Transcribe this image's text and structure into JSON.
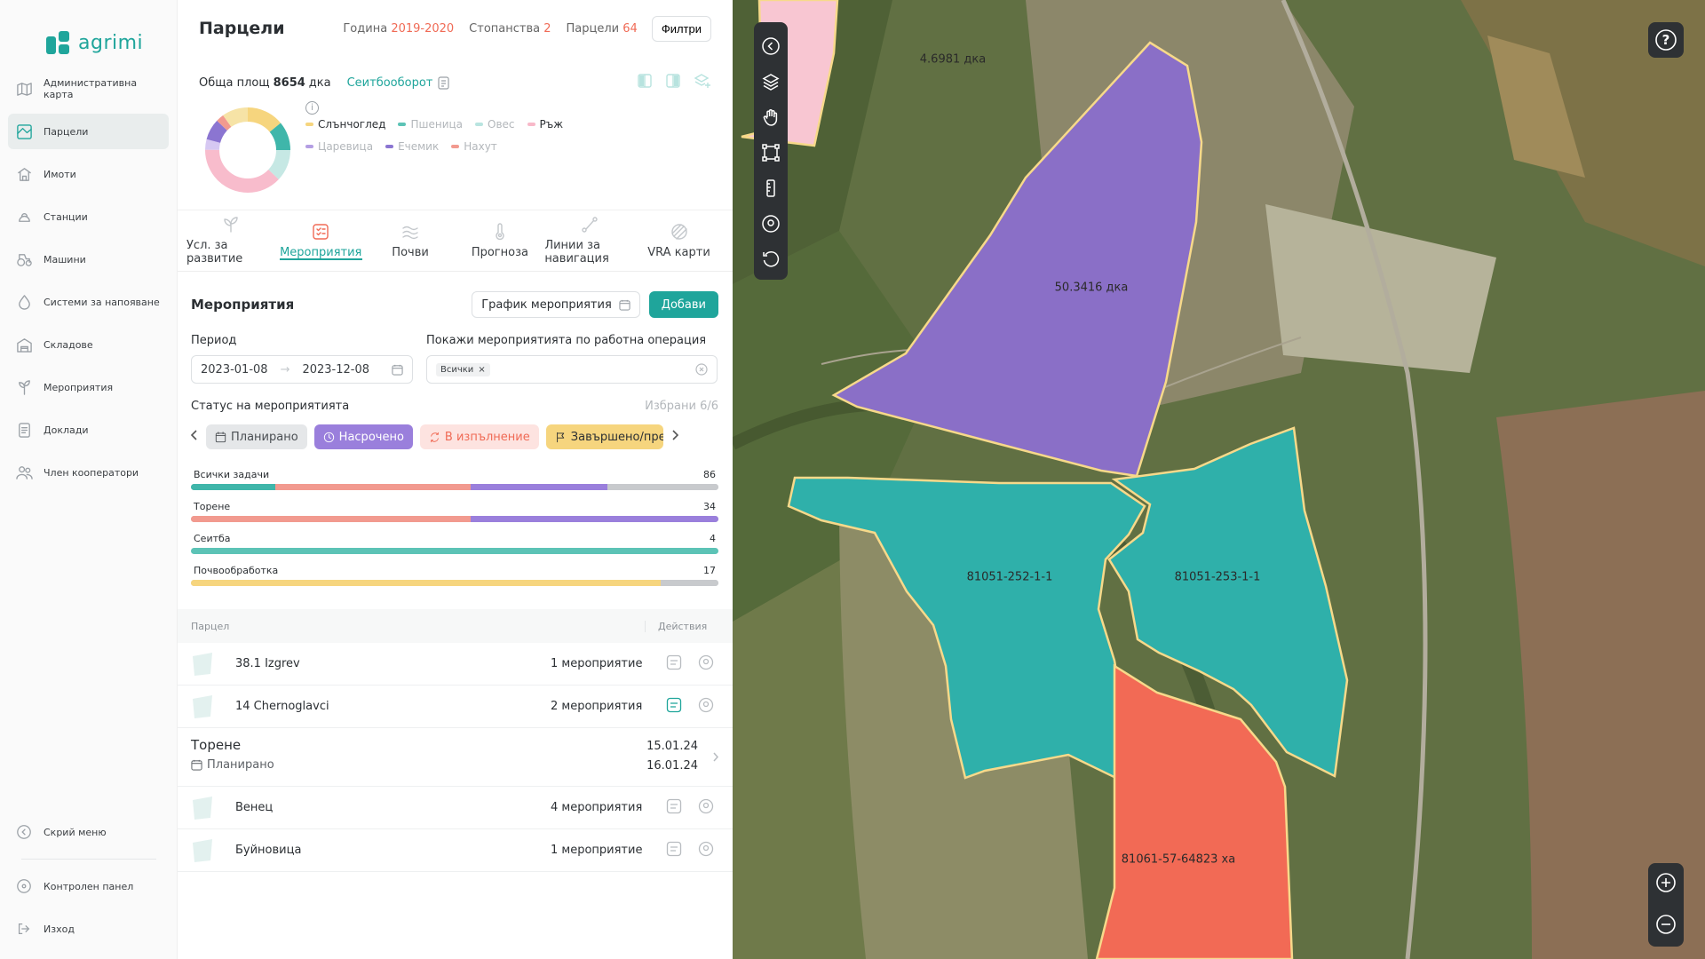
{
  "app": {
    "name": "agrimi",
    "brand_color": "#1fa59b",
    "accent_color": "#f06a55"
  },
  "sidebar": {
    "items": [
      {
        "label": "Административна карта",
        "icon": "map-icon"
      },
      {
        "label": "Парцели",
        "icon": "parcel-icon",
        "active": true
      },
      {
        "label": "Имоти",
        "icon": "property-icon"
      },
      {
        "label": "Станции",
        "icon": "station-icon"
      },
      {
        "label": "Машини",
        "icon": "tractor-icon"
      },
      {
        "label": "Системи за напояване",
        "icon": "drop-icon"
      },
      {
        "label": "Складове",
        "icon": "warehouse-icon"
      },
      {
        "label": "Мероприятия",
        "icon": "plant-icon"
      },
      {
        "label": "Доклади",
        "icon": "report-icon"
      },
      {
        "label": "Член кооператори",
        "icon": "members-icon"
      }
    ],
    "bottom": {
      "collapse": "Скрий меню",
      "dashboard": "Контролен панел",
      "logout": "Изход"
    }
  },
  "header": {
    "title": "Парцели",
    "year_label": "Година",
    "year_value": "2019-2020",
    "farms_label": "Стопанства",
    "farms_value": "2",
    "parcels_label": "Парцели",
    "parcels_value": "64",
    "filters_button": "Филтри"
  },
  "summary": {
    "area_label": "Обща площ",
    "area_value": "8654",
    "area_unit": "дка",
    "rotation_link": "Сеитбооборот"
  },
  "crops": {
    "legend": [
      {
        "name": "Слънчоглед",
        "color": "#f6d57e",
        "dim": false
      },
      {
        "name": "Пшеница",
        "color": "#5cc3b6",
        "dim": true
      },
      {
        "name": "Овес",
        "color": "#b9e4e0",
        "dim": true
      },
      {
        "name": "Ръж",
        "color": "#f8b9c9",
        "dim": false
      },
      {
        "name": "Царевица",
        "color": "#b49ee3",
        "dim": true
      },
      {
        "name": "Ечемик",
        "color": "#8b75d1",
        "dim": true
      },
      {
        "name": "Нахут",
        "color": "#f29a8f",
        "dim": true
      }
    ],
    "shares": [
      {
        "name": "Слънчоглед",
        "value": 0.14,
        "color": "#f6d57e"
      },
      {
        "name": "Пшеница",
        "value": 0.11,
        "color": "#3fb6aa"
      },
      {
        "name": "Овес",
        "value": 0.12,
        "color": "#c6e8e4"
      },
      {
        "name": "Ръж",
        "value": 0.38,
        "color": "#f8bccc"
      },
      {
        "name": "Царевица",
        "value": 0.04,
        "color": "#d6c8f2"
      },
      {
        "name": "Ечемик",
        "value": 0.08,
        "color": "#8b75d1"
      },
      {
        "name": "Нахут",
        "value": 0.03,
        "color": "#f29a8f"
      },
      {
        "name": "Other",
        "value": 0.1,
        "color": "#f6e3a6"
      }
    ]
  },
  "tabs": [
    {
      "label": "Усл. за развитие",
      "icon": "sprout-icon"
    },
    {
      "label": "Мероприятия",
      "icon": "tasks-icon",
      "active": true
    },
    {
      "label": "Почви",
      "icon": "soil-icon"
    },
    {
      "label": "Прогноза",
      "icon": "thermometer-icon"
    },
    {
      "label": "Линии за навигация",
      "icon": "route-icon"
    },
    {
      "label": "VRA карти",
      "icon": "vra-icon"
    }
  ],
  "events": {
    "title": "Мероприятия",
    "schedule_button": "График мероприятия",
    "add_button": "Добави",
    "period_label": "Период",
    "period_from": "2023-01-08",
    "period_to": "2023-12-08",
    "operation_label": "Покажи мероприятията по работна операция",
    "operation_chip": "Всички",
    "status_label": "Статус на мероприятията",
    "selected_count": "Избрани 6/6",
    "statuses": [
      {
        "label": "Планирано",
        "bg": "#e5e7e9",
        "color": "#4a4e52",
        "icon": "calendar-icon"
      },
      {
        "label": "Насрочено",
        "bg": "#9a7fdc",
        "color": "#ffffff",
        "icon": "clock-icon"
      },
      {
        "label": "В изпълнение",
        "bg": "#fde3e0",
        "color": "#f06a55",
        "icon": "refresh-icon"
      },
      {
        "label": "Завършено/предл",
        "bg": "#f6d57e",
        "color": "#2b2f33",
        "icon": "flag-icon"
      }
    ],
    "progress": [
      {
        "label": "Всички задачи",
        "count": "86",
        "segments": [
          {
            "value": 0.16,
            "color": "#3fb6aa"
          },
          {
            "value": 0.37,
            "color": "#f29a8f"
          },
          {
            "value": 0.26,
            "color": "#9a7fdc"
          },
          {
            "value": 0.21,
            "color": "#c8cacd"
          }
        ]
      },
      {
        "label": "Торене",
        "count": "34",
        "segments": [
          {
            "value": 0.53,
            "color": "#f29a8f"
          },
          {
            "value": 0.47,
            "color": "#9a7fdc"
          }
        ]
      },
      {
        "label": "Сеитба",
        "count": "4",
        "segments": [
          {
            "value": 1.0,
            "color": "#5cc3b6"
          }
        ]
      },
      {
        "label": "Почвообработка",
        "count": "17",
        "segments": [
          {
            "value": 0.89,
            "color": "#f6d57e"
          },
          {
            "value": 0.11,
            "color": "#c8cacd"
          }
        ]
      }
    ]
  },
  "table": {
    "col_parcel": "Парцел",
    "col_actions": "Действия",
    "rows": [
      {
        "name": "38.1 Izgrev",
        "count": "1 мероприятие",
        "highlight": false
      },
      {
        "name": "14 Chernoglavci",
        "count": "2 мероприятия",
        "highlight": true
      }
    ],
    "event": {
      "name": "Торене",
      "status": "Планирано",
      "date_from": "15.01.24",
      "date_to": "16.01.24"
    },
    "rows_after": [
      {
        "name": "Венец",
        "count": "4 мероприятия"
      },
      {
        "name": "Буйновица",
        "count": "1 мероприятие"
      }
    ]
  },
  "map": {
    "parcels": [
      {
        "label": "4.6981 дка",
        "color": "#f8c6d2"
      },
      {
        "label": "50.3416 дка",
        "color": "#8a6fc7"
      },
      {
        "label": "81051-252-1-1",
        "color": "#2fb0aa"
      },
      {
        "label": "81051-253-1-1",
        "color": "#2fb0aa"
      },
      {
        "label": "81061-57-64823 ха",
        "color": "#f26a55"
      }
    ],
    "help": "?"
  }
}
